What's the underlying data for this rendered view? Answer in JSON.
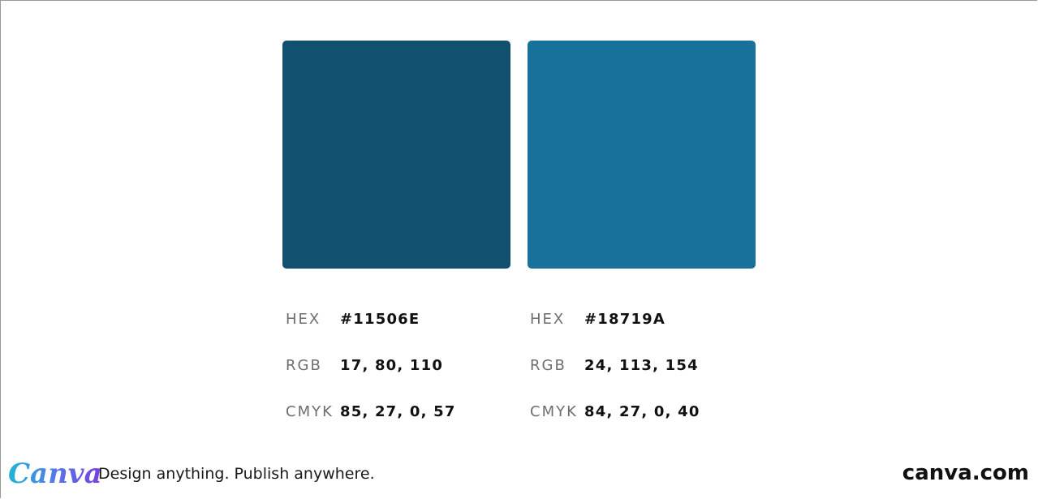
{
  "colors": [
    {
      "swatch": "#11506E",
      "hex_label": "HEX",
      "hex_value": "#11506E",
      "rgb_label": "RGB",
      "rgb_value": "17, 80, 110",
      "cmyk_label": "CMYK",
      "cmyk_value": "85, 27, 0, 57"
    },
    {
      "swatch": "#18719A",
      "hex_label": "HEX",
      "hex_value": "#18719A",
      "rgb_label": "RGB",
      "rgb_value": "24, 113, 154",
      "cmyk_label": "CMYK",
      "cmyk_value": "84, 27, 0, 40"
    }
  ],
  "footer": {
    "logo": "Canva",
    "tagline": "Design anything. Publish anywhere.",
    "domain": "canva.com"
  }
}
